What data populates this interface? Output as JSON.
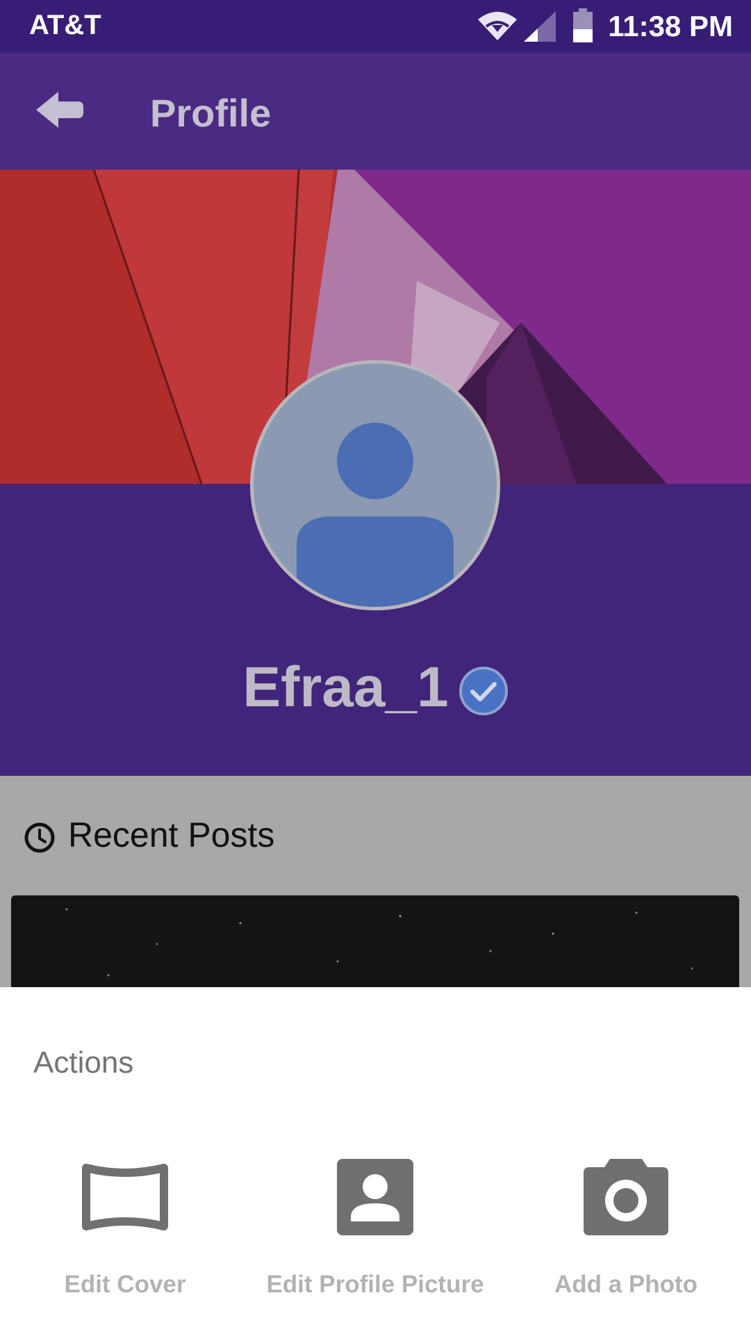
{
  "status_bar": {
    "carrier": "AT&T",
    "time": "11:38 PM"
  },
  "app_bar": {
    "title": "Profile",
    "back_icon": "arrow-back-icon"
  },
  "profile": {
    "username": "Efraa_1",
    "verified": true
  },
  "recent_posts": {
    "label": "Recent Posts"
  },
  "actions_sheet": {
    "heading": "Actions",
    "items": [
      {
        "label": "Edit Cover",
        "icon": "panorama-icon"
      },
      {
        "label": "Edit Profile Picture",
        "icon": "account-box-icon"
      },
      {
        "label": "Add a Photo",
        "icon": "camera-icon"
      }
    ]
  },
  "colors": {
    "status_bar": "#381d77",
    "app_bar": "#4a2a82",
    "profile_band": "#40257a",
    "accent_verify": "#4a72c4"
  }
}
